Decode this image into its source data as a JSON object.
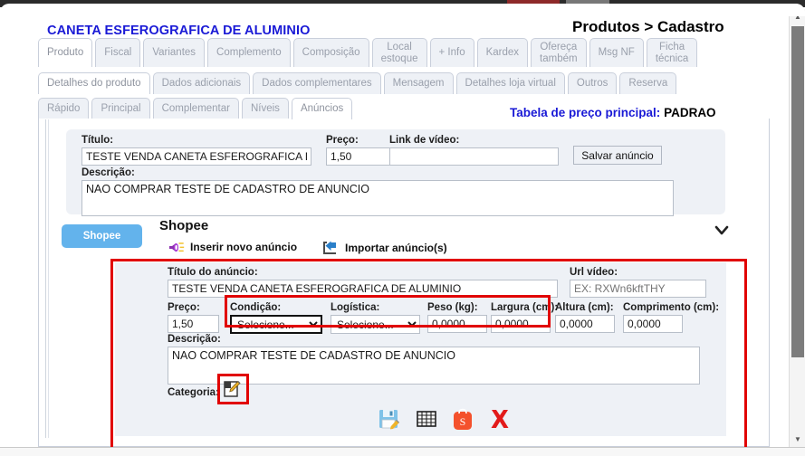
{
  "header": {
    "product_title": "CANETA ESFEROGRAFICA DE ALUMINIO",
    "breadcrumb": "Produtos > Cadastro",
    "price_table_label": "Tabela de preço principal:",
    "price_table_value": "PADRAO",
    "accent_blue": "#1a1ad6"
  },
  "tabs": {
    "row1": [
      {
        "label": "Produto",
        "active": true
      },
      {
        "label": "Fiscal",
        "active": false
      },
      {
        "label": "Variantes",
        "active": false
      },
      {
        "label": "Complemento",
        "active": false
      },
      {
        "label": "Composição",
        "active": false
      },
      {
        "label": "Local\nestoque",
        "active": false
      },
      {
        "label": "+ Info",
        "active": false
      },
      {
        "label": "Kardex",
        "active": false
      },
      {
        "label": "Ofereça\ntambém",
        "active": false
      },
      {
        "label": "Msg NF",
        "active": false
      },
      {
        "label": "Ficha\ntécnica",
        "active": false
      }
    ],
    "row2": [
      {
        "label": "Detalhes do produto",
        "active": true
      },
      {
        "label": "Dados adicionais",
        "active": false
      },
      {
        "label": "Dados complementares",
        "active": false
      },
      {
        "label": "Mensagem",
        "active": false
      },
      {
        "label": "Detalhes loja virtual",
        "active": false
      },
      {
        "label": "Outros",
        "active": false
      },
      {
        "label": "Reserva",
        "active": false
      }
    ],
    "row3": [
      {
        "label": "Rápido",
        "active": false
      },
      {
        "label": "Principal",
        "active": false
      },
      {
        "label": "Complementar",
        "active": false
      },
      {
        "label": "Níveis",
        "active": false
      },
      {
        "label": "Anúncios",
        "active": true
      }
    ]
  },
  "main_form": {
    "titulo_label": "Título:",
    "titulo_value": "TESTE VENDA CANETA ESFEROGRAFICA DE",
    "preco_label": "Preço:",
    "preco_value": "1,50",
    "link_video_label": "Link de vídeo:",
    "link_video_value": "",
    "salvar_button": "Salvar anúncio",
    "descricao_label": "Descrição:",
    "descricao_value": "NAO COMPRAR TESTE DE CADASTRO DE ANUNCIO"
  },
  "shopee": {
    "button_label": "Shopee",
    "button_color": "#63b3ec",
    "section_title": "Shopee",
    "insert_link": "Inserir novo anúncio",
    "insert_icon": "megaphone-icon",
    "import_link": "Importar anúncio(s)",
    "import_icon": "import-arrow-icon",
    "collapse_icon": "chevron-down-icon"
  },
  "ad_form": {
    "titulo_anuncio_label": "Título do anúncio:",
    "titulo_anuncio_value": "TESTE VENDA CANETA ESFEROGRAFICA DE ALUMINIO",
    "url_video_label": "Url vídeo:",
    "url_video_value": "",
    "url_video_placeholder": "EX: RXWn6kftTHY",
    "preco_label": "Preço:",
    "preco_value": "1,50",
    "condicao_label": "Condição:",
    "condicao_value": "Selecione...",
    "logistica_label": "Logística:",
    "logistica_value": "Selecione...",
    "peso_label": "Peso (kg):",
    "peso_value": "0,0000",
    "largura_label": "Largura (cm):",
    "largura_value": "0,0000",
    "altura_label": "Altura (cm):",
    "altura_value": "0,0000",
    "comprimento_label": "Comprimento (cm):",
    "comprimento_value": "0,0000",
    "descricao_label": "Descrição:",
    "descricao_value": "NAO COMPRAR TESTE DE CADASTRO DE ANUNCIO",
    "categoria_label": "Categoria:",
    "categoria_icon": "edit-document-icon",
    "highlight_color": "#e10000"
  },
  "action_icons": [
    {
      "name": "save-floppy-icon",
      "title": "Salvar"
    },
    {
      "name": "grid-table-icon",
      "title": "Grade"
    },
    {
      "name": "shopee-bag-icon",
      "title": "Shopee"
    },
    {
      "name": "delete-x-icon",
      "title": "Excluir"
    }
  ],
  "scrollbar": {
    "up_arrow": "▲",
    "down_arrow": "▼"
  }
}
